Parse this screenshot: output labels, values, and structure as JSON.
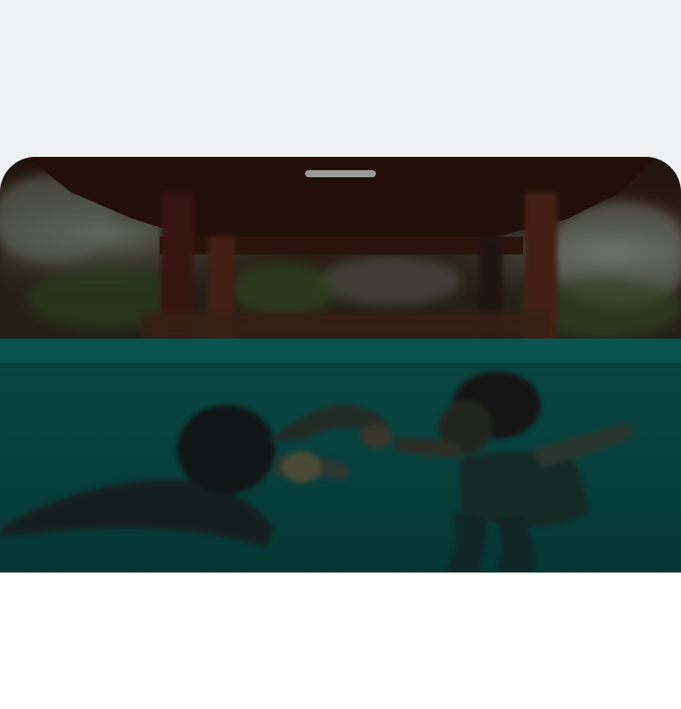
{
  "sheet": {
    "handle_icon": "drag-handle-icon",
    "media": {
      "subject": "couple-swimming-underwater-photo",
      "background_color": "#eef0f2",
      "water_color": "#0b5c57",
      "wood_color": "#3a1d12"
    }
  }
}
